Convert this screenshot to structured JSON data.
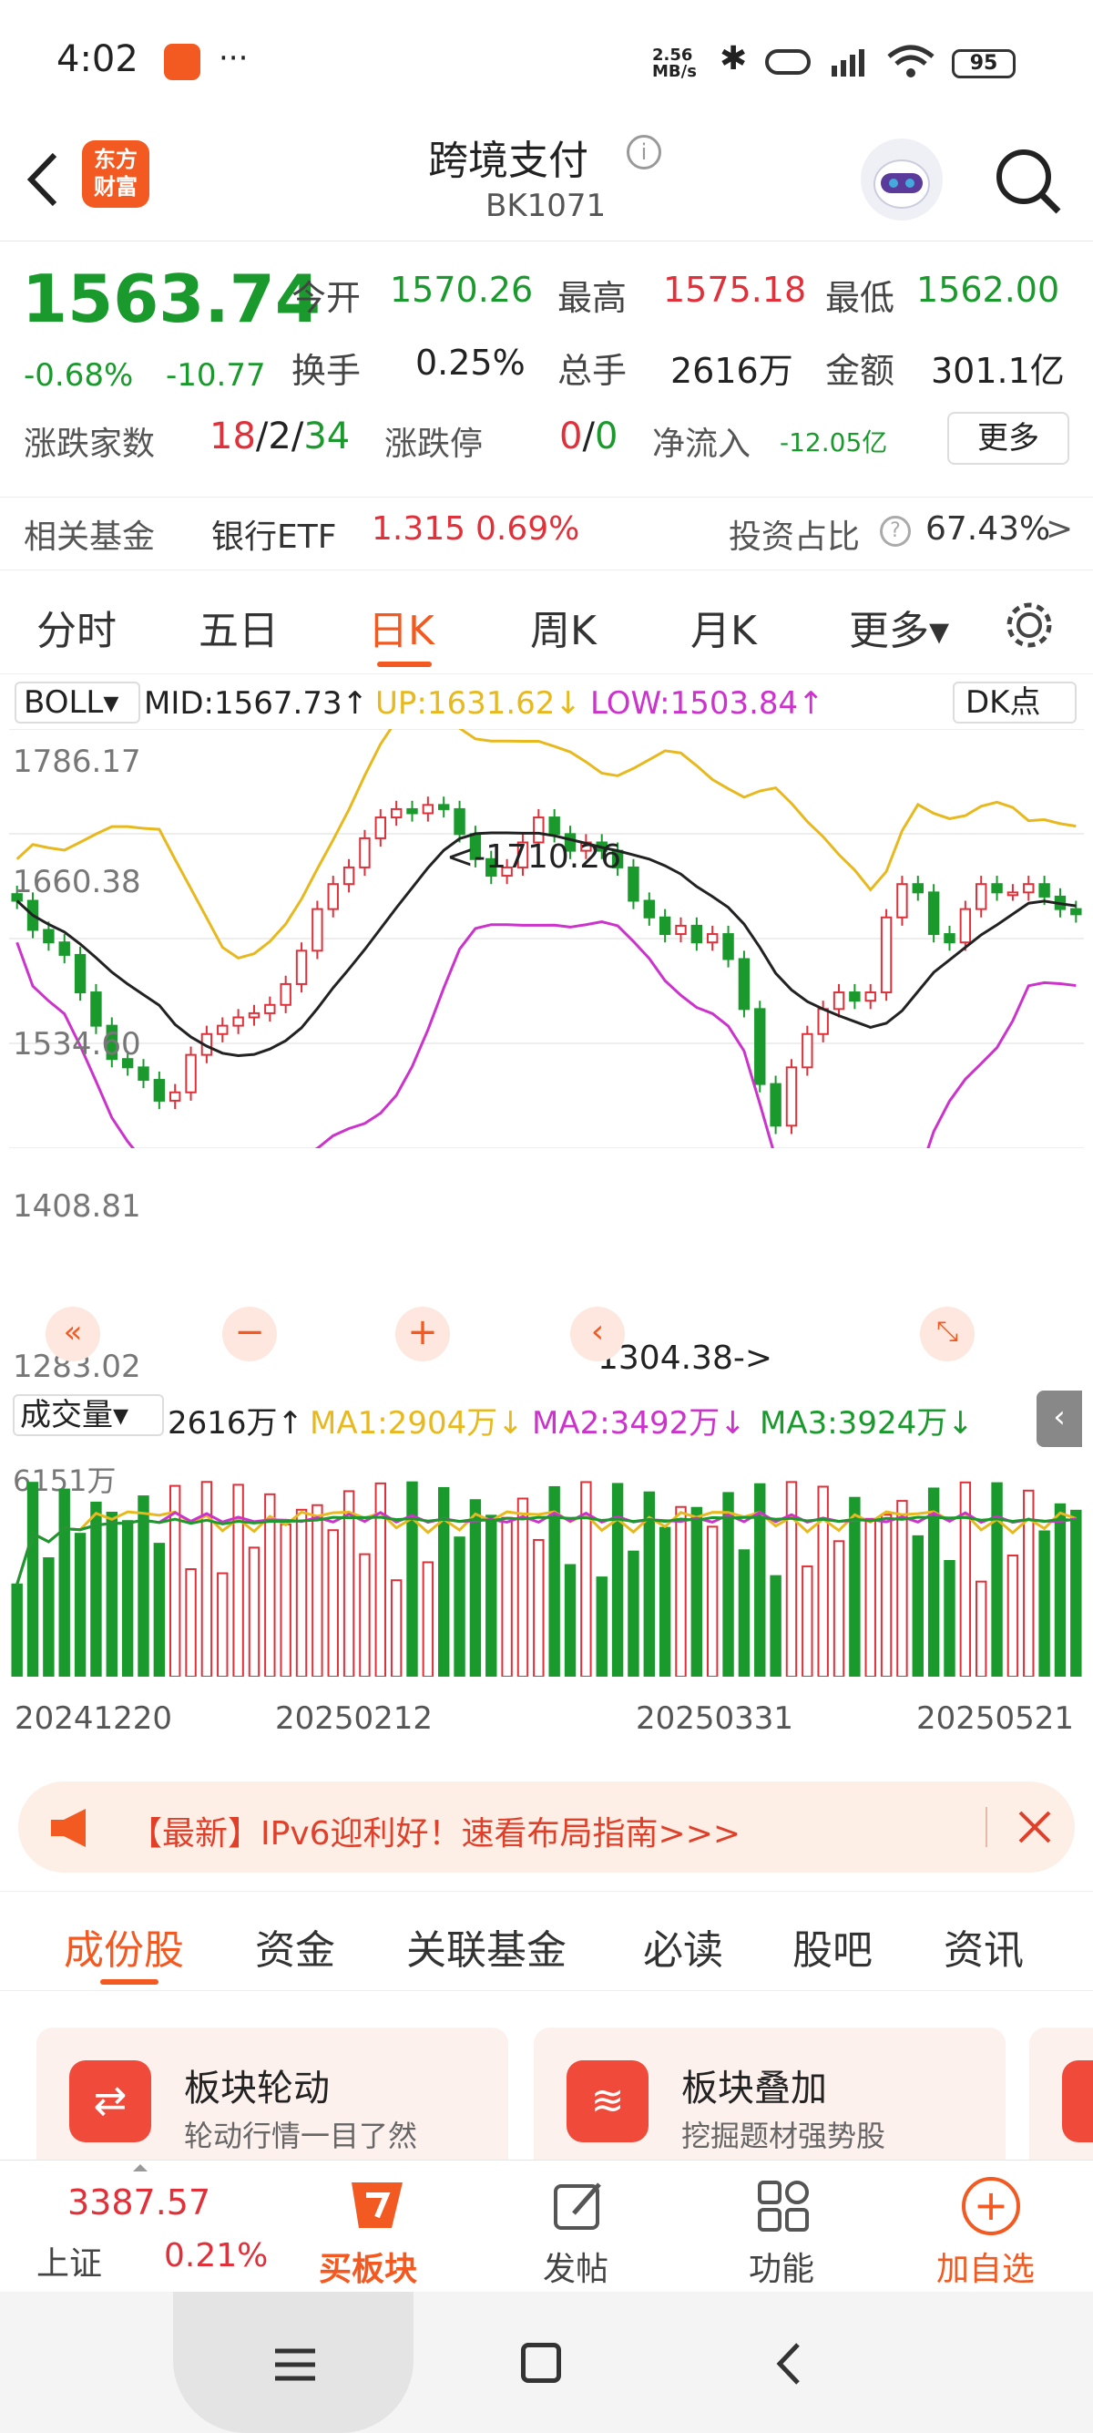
{
  "status": {
    "time": "4:02",
    "more": "···",
    "net_speed_top": "2.56",
    "net_speed_bottom": "MB/s",
    "battery": "95"
  },
  "header": {
    "logo_top": "东方",
    "logo_bottom": "财富",
    "title": "跨境支付",
    "code": "BK1071"
  },
  "quote": {
    "price": "1563.74",
    "change_pct": "-0.68%",
    "change": "-10.77",
    "open_label": "今开",
    "open": "1570.26",
    "high_label": "最高",
    "high": "1575.18",
    "low_label": "最低",
    "low": "1562.00",
    "turnover_label": "换手",
    "turnover": "0.25%",
    "volume_label": "总手",
    "volume": "2616万",
    "amount_label": "金额",
    "amount": "301.1亿",
    "updown_label": "涨跌家数",
    "up_count": "18",
    "slash1": "/",
    "flat_count": "2",
    "slash2": "/",
    "down_count": "34",
    "limit_label": "涨跌停",
    "limit_up": "0",
    "slash3": "/",
    "limit_down": "0",
    "inflow_label": "净流入",
    "inflow": "-12.05亿",
    "more_button": "更多"
  },
  "fund": {
    "label": "相关基金",
    "name": "银行ETF",
    "price": "1.315",
    "pct": "0.69%",
    "ratio_label": "投资占比",
    "ratio": "67.43%",
    "arrow": ">"
  },
  "period_tabs": [
    {
      "label": "分时"
    },
    {
      "label": "五日"
    },
    {
      "label": "日K"
    },
    {
      "label": "周K"
    },
    {
      "label": "月K"
    },
    {
      "label": "更多▾"
    }
  ],
  "boll": {
    "selector": "BOLL▾",
    "mid": "MID:1567.73↑",
    "up": "UP:1631.62↓",
    "low": "LOW:1503.84↑",
    "dk": "DK点"
  },
  "chart_data": {
    "type": "candlestick",
    "y_ticks": [
      "1786.17",
      "1660.38",
      "1534.60",
      "1408.81",
      "1283.02"
    ],
    "ylim": [
      1283.02,
      1786.17
    ],
    "high_marker": "<-1710.26",
    "low_marker": "1304.38->",
    "x_labels": [
      "20241220",
      "20250212",
      "20250331",
      "20250521"
    ],
    "colors": {
      "up": "#e0303a",
      "down": "#1a9a2d",
      "mid": "#222222",
      "upper": "#e8b91e",
      "lower": "#cc33cc"
    },
    "closes": [
      1580,
      1545,
      1530,
      1515,
      1470,
      1430,
      1390,
      1380,
      1365,
      1340,
      1350,
      1395,
      1420,
      1430,
      1440,
      1445,
      1455,
      1480,
      1520,
      1570,
      1600,
      1620,
      1655,
      1680,
      1690,
      1685,
      1695,
      1690,
      1660,
      1630,
      1610,
      1620,
      1650,
      1680,
      1660,
      1640,
      1650,
      1640,
      1620,
      1580,
      1560,
      1540,
      1550,
      1530,
      1540,
      1510,
      1450,
      1360,
      1310,
      1380,
      1420,
      1450,
      1470,
      1460,
      1470,
      1560,
      1600,
      1590,
      1540,
      1530,
      1570,
      1600,
      1590,
      1590,
      1600,
      1585,
      1570,
      1563.74
    ],
    "volume": {
      "selector": "成交量▾",
      "current": "2616万↑",
      "ma1": "MA1:2904万↓",
      "ma2": "MA2:3492万↓",
      "ma3": "MA3:3924万↓",
      "max_label": "6151万"
    }
  },
  "banner": {
    "text": "【最新】IPv6迎利好！速看布局指南>>>"
  },
  "sub_tabs": [
    {
      "label": "成份股"
    },
    {
      "label": "资金"
    },
    {
      "label": "关联基金"
    },
    {
      "label": "必读"
    },
    {
      "label": "股吧"
    },
    {
      "label": "资讯"
    }
  ],
  "cards": [
    {
      "title": "板块轮动",
      "subtitle": "轮动行情一目了然"
    },
    {
      "title": "板块叠加",
      "subtitle": "挖掘题材强势股"
    }
  ],
  "bottom_nav": {
    "index_value": "3387.57",
    "index_name": "上证",
    "index_pct": "0.21%",
    "buy": "买板块",
    "post": "发帖",
    "func": "功能",
    "add": "加自选"
  }
}
